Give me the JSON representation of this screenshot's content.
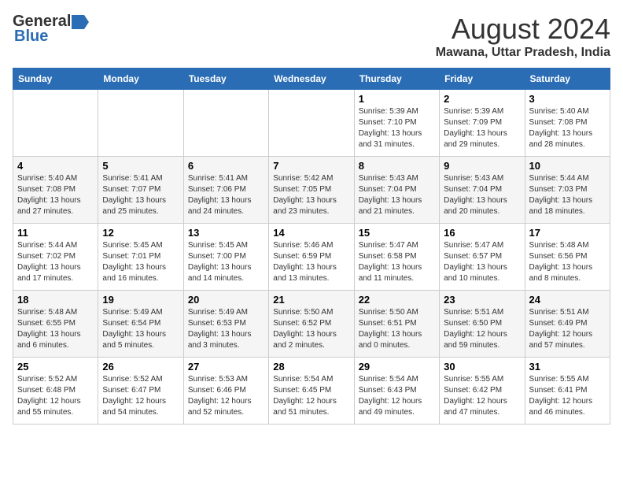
{
  "logo": {
    "general": "General",
    "blue": "Blue"
  },
  "title": "August 2024",
  "subtitle": "Mawana, Uttar Pradesh, India",
  "days_of_week": [
    "Sunday",
    "Monday",
    "Tuesday",
    "Wednesday",
    "Thursday",
    "Friday",
    "Saturday"
  ],
  "weeks": [
    [
      {
        "day": "",
        "info": ""
      },
      {
        "day": "",
        "info": ""
      },
      {
        "day": "",
        "info": ""
      },
      {
        "day": "",
        "info": ""
      },
      {
        "day": "1",
        "info": "Sunrise: 5:39 AM\nSunset: 7:10 PM\nDaylight: 13 hours\nand 31 minutes."
      },
      {
        "day": "2",
        "info": "Sunrise: 5:39 AM\nSunset: 7:09 PM\nDaylight: 13 hours\nand 29 minutes."
      },
      {
        "day": "3",
        "info": "Sunrise: 5:40 AM\nSunset: 7:08 PM\nDaylight: 13 hours\nand 28 minutes."
      }
    ],
    [
      {
        "day": "4",
        "info": "Sunrise: 5:40 AM\nSunset: 7:08 PM\nDaylight: 13 hours\nand 27 minutes."
      },
      {
        "day": "5",
        "info": "Sunrise: 5:41 AM\nSunset: 7:07 PM\nDaylight: 13 hours\nand 25 minutes."
      },
      {
        "day": "6",
        "info": "Sunrise: 5:41 AM\nSunset: 7:06 PM\nDaylight: 13 hours\nand 24 minutes."
      },
      {
        "day": "7",
        "info": "Sunrise: 5:42 AM\nSunset: 7:05 PM\nDaylight: 13 hours\nand 23 minutes."
      },
      {
        "day": "8",
        "info": "Sunrise: 5:43 AM\nSunset: 7:04 PM\nDaylight: 13 hours\nand 21 minutes."
      },
      {
        "day": "9",
        "info": "Sunrise: 5:43 AM\nSunset: 7:04 PM\nDaylight: 13 hours\nand 20 minutes."
      },
      {
        "day": "10",
        "info": "Sunrise: 5:44 AM\nSunset: 7:03 PM\nDaylight: 13 hours\nand 18 minutes."
      }
    ],
    [
      {
        "day": "11",
        "info": "Sunrise: 5:44 AM\nSunset: 7:02 PM\nDaylight: 13 hours\nand 17 minutes."
      },
      {
        "day": "12",
        "info": "Sunrise: 5:45 AM\nSunset: 7:01 PM\nDaylight: 13 hours\nand 16 minutes."
      },
      {
        "day": "13",
        "info": "Sunrise: 5:45 AM\nSunset: 7:00 PM\nDaylight: 13 hours\nand 14 minutes."
      },
      {
        "day": "14",
        "info": "Sunrise: 5:46 AM\nSunset: 6:59 PM\nDaylight: 13 hours\nand 13 minutes."
      },
      {
        "day": "15",
        "info": "Sunrise: 5:47 AM\nSunset: 6:58 PM\nDaylight: 13 hours\nand 11 minutes."
      },
      {
        "day": "16",
        "info": "Sunrise: 5:47 AM\nSunset: 6:57 PM\nDaylight: 13 hours\nand 10 minutes."
      },
      {
        "day": "17",
        "info": "Sunrise: 5:48 AM\nSunset: 6:56 PM\nDaylight: 13 hours\nand 8 minutes."
      }
    ],
    [
      {
        "day": "18",
        "info": "Sunrise: 5:48 AM\nSunset: 6:55 PM\nDaylight: 13 hours\nand 6 minutes."
      },
      {
        "day": "19",
        "info": "Sunrise: 5:49 AM\nSunset: 6:54 PM\nDaylight: 13 hours\nand 5 minutes."
      },
      {
        "day": "20",
        "info": "Sunrise: 5:49 AM\nSunset: 6:53 PM\nDaylight: 13 hours\nand 3 minutes."
      },
      {
        "day": "21",
        "info": "Sunrise: 5:50 AM\nSunset: 6:52 PM\nDaylight: 13 hours\nand 2 minutes."
      },
      {
        "day": "22",
        "info": "Sunrise: 5:50 AM\nSunset: 6:51 PM\nDaylight: 13 hours\nand 0 minutes."
      },
      {
        "day": "23",
        "info": "Sunrise: 5:51 AM\nSunset: 6:50 PM\nDaylight: 12 hours\nand 59 minutes."
      },
      {
        "day": "24",
        "info": "Sunrise: 5:51 AM\nSunset: 6:49 PM\nDaylight: 12 hours\nand 57 minutes."
      }
    ],
    [
      {
        "day": "25",
        "info": "Sunrise: 5:52 AM\nSunset: 6:48 PM\nDaylight: 12 hours\nand 55 minutes."
      },
      {
        "day": "26",
        "info": "Sunrise: 5:52 AM\nSunset: 6:47 PM\nDaylight: 12 hours\nand 54 minutes."
      },
      {
        "day": "27",
        "info": "Sunrise: 5:53 AM\nSunset: 6:46 PM\nDaylight: 12 hours\nand 52 minutes."
      },
      {
        "day": "28",
        "info": "Sunrise: 5:54 AM\nSunset: 6:45 PM\nDaylight: 12 hours\nand 51 minutes."
      },
      {
        "day": "29",
        "info": "Sunrise: 5:54 AM\nSunset: 6:43 PM\nDaylight: 12 hours\nand 49 minutes."
      },
      {
        "day": "30",
        "info": "Sunrise: 5:55 AM\nSunset: 6:42 PM\nDaylight: 12 hours\nand 47 minutes."
      },
      {
        "day": "31",
        "info": "Sunrise: 5:55 AM\nSunset: 6:41 PM\nDaylight: 12 hours\nand 46 minutes."
      }
    ]
  ]
}
